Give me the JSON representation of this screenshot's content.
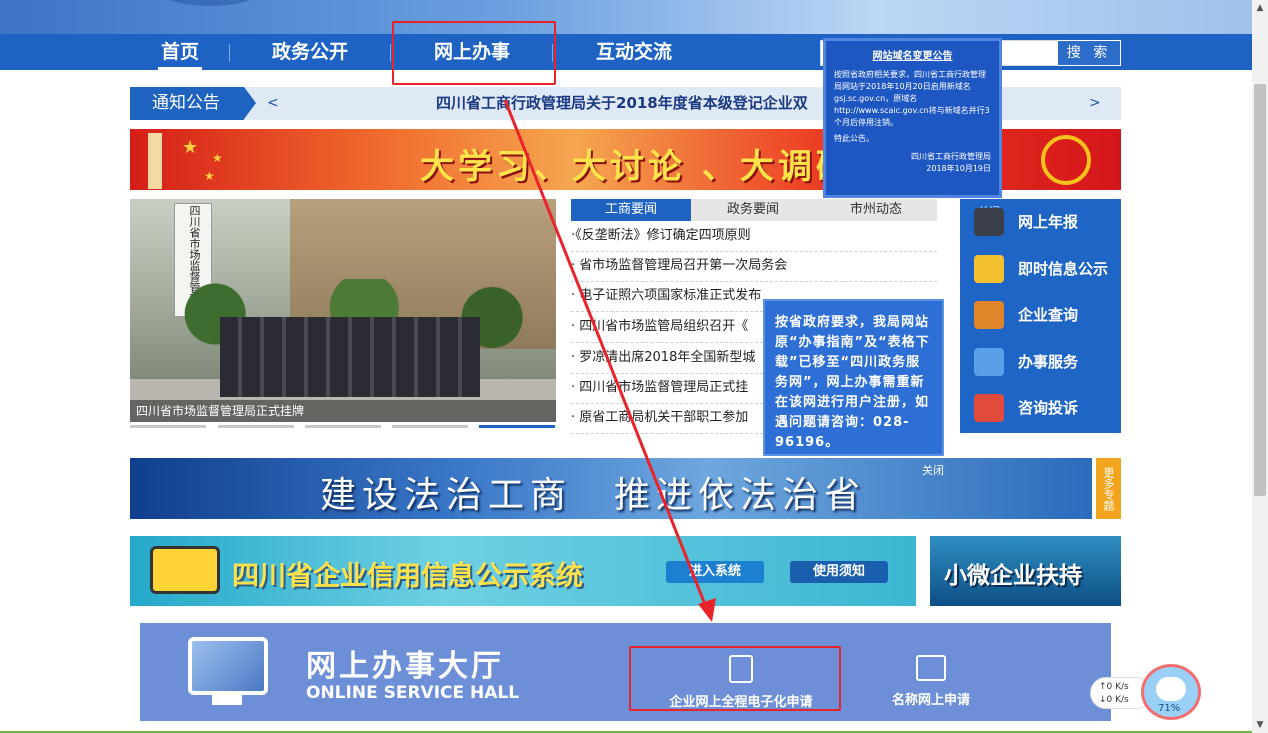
{
  "nav": {
    "items": [
      "首页",
      "政务公开",
      "网上办事",
      "互动交流"
    ],
    "search_label": "搜 索"
  },
  "notice": {
    "label": "通知公告",
    "prev": "<",
    "next": ">",
    "text": "四川省工商行政管理局关于2018年度省本级登记企业双"
  },
  "red_banner": {
    "slogan": "大学习、大讨论 、大调研"
  },
  "popup_top": {
    "title": "网站域名变更公告",
    "body": "按照省政府相关要求，四川省工商行政管理局网站于2018年10月20日启用新域名gsj.sc.gov.cn，原域名http://www.scaic.gov.cn将与新域名并行3个月后停用注销。",
    "closing": "特此公告。",
    "signer": "四川省工商行政管理局",
    "date": "2018年10月19日"
  },
  "photo": {
    "caption": "四川省市场监督管理局正式挂牌",
    "sign_text": "四川省市场监督管理局"
  },
  "tabs": [
    "工商要闻",
    "政务要闻",
    "市州动态"
  ],
  "news": [
    "·《反垄断法》修订确定四项原则",
    "· 省市场监督管理局召开第一次局务会",
    "· 电子证照六项国家标准正式发布",
    "· 四川省市场监管局组织召开《",
    "· 罗凉清出席2018年全国新型城",
    "· 四川省市场监督管理局正式挂",
    "· 原省工商局机关干部职工参加"
  ],
  "popup_mid": {
    "text": "按省政府要求，我局网站原“办事指南”及“表格下载”已移至“四川政务服务网”，网上办事需重新在该网进行用户注册，如遇问题请咨询：028-96196。"
  },
  "service": {
    "close": "关闭",
    "items": [
      {
        "label": "网上年报",
        "icon": "laptop-icon",
        "color": "#3a3f4a"
      },
      {
        "label": "即时信息公示",
        "icon": "clipboard-icon",
        "color": "#f3c12f"
      },
      {
        "label": "企业查询",
        "icon": "briefcase-icon",
        "color": "#e0852a"
      },
      {
        "label": "办事服务",
        "icon": "pencil-icon",
        "color": "#5aa0e8"
      },
      {
        "label": "咨询投诉",
        "icon": "mail-icon",
        "color": "#e24b3a"
      }
    ]
  },
  "law_banner": {
    "text": "建设法治工商　推进依法治省",
    "close": "关闭",
    "more": "更多专题"
  },
  "credit": {
    "title": "四川省企业信用信息公示系统",
    "enter": "进入系统",
    "guide": "使用须知"
  },
  "small_biz": {
    "title": "小微企业扶持"
  },
  "hall": {
    "title_cn": "网上办事大厅",
    "title_en": "ONLINE SERVICE HALL",
    "svc1": "企业网上全程电子化申请",
    "svc2": "名称网上申请"
  },
  "speed": {
    "up": "↑0 K/s",
    "down": "↓0 K/s"
  },
  "chat": {
    "percent": "71%"
  },
  "colors": {
    "nav_blue": "#1e63c3",
    "highlight_red": "#e8232a"
  }
}
